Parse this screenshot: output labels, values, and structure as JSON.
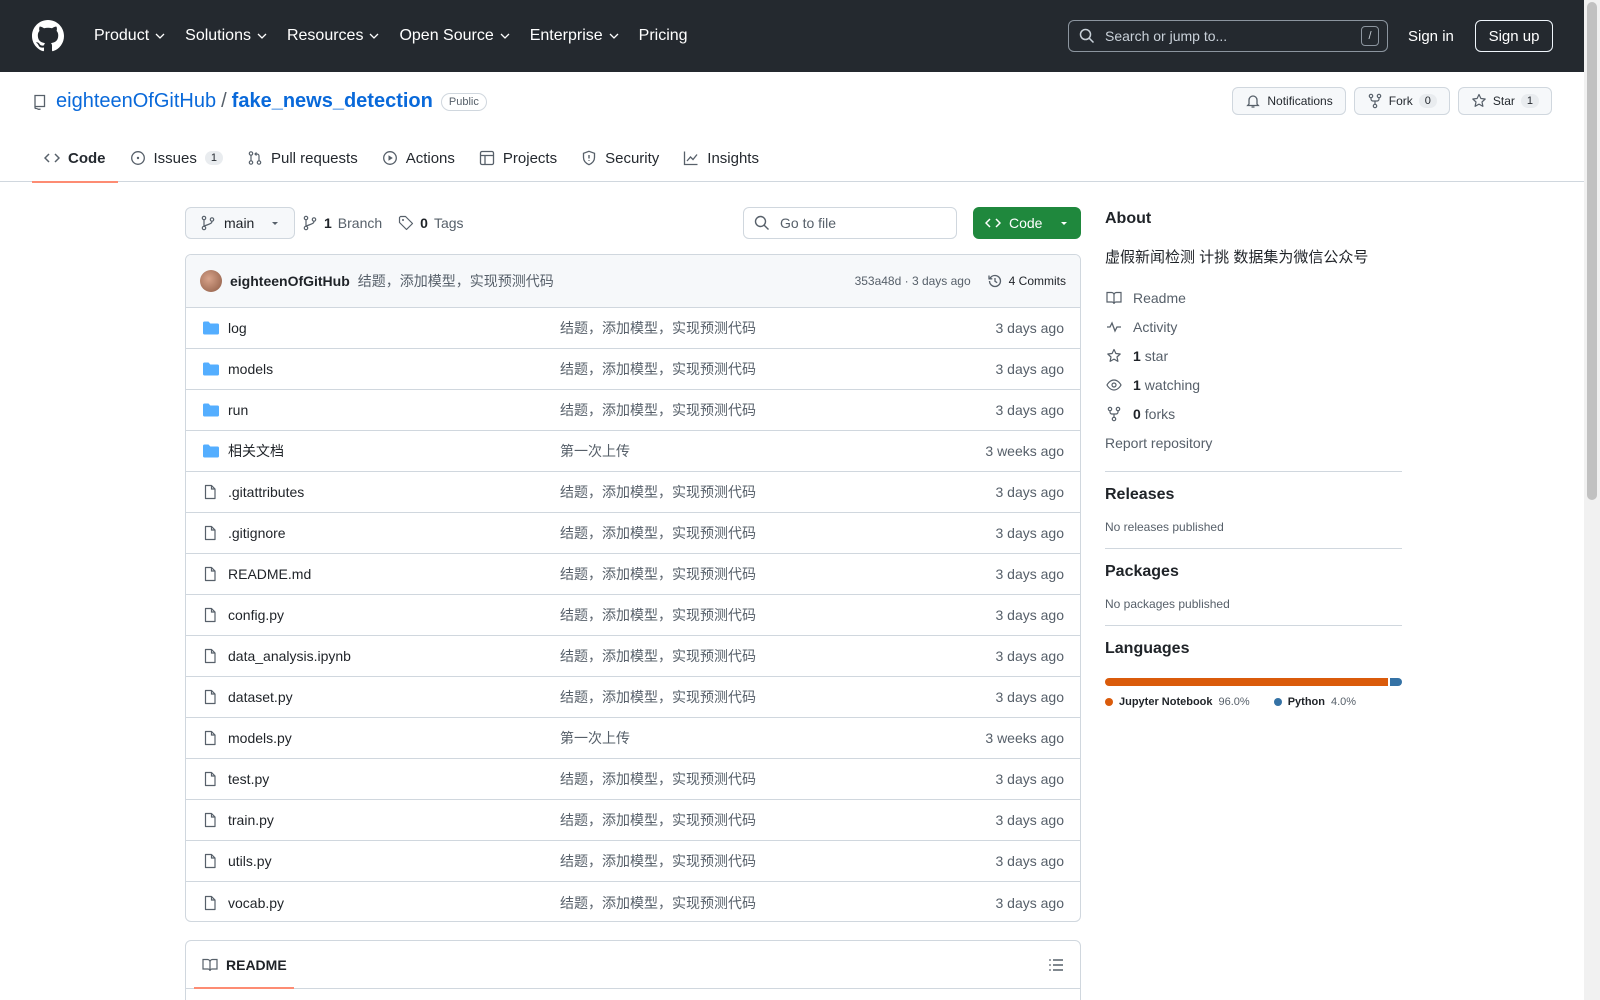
{
  "header": {
    "nav": [
      "Product",
      "Solutions",
      "Resources",
      "Open Source",
      "Enterprise",
      "Pricing"
    ],
    "search_placeholder": "Search or jump to...",
    "search_shortcut": "/",
    "sign_in": "Sign in",
    "sign_up": "Sign up"
  },
  "repo": {
    "owner": "eighteenOfGitHub",
    "separator": "/",
    "name": "fake_news_detection",
    "visibility": "Public",
    "notifications": "Notifications",
    "fork_label": "Fork",
    "fork_count": "0",
    "star_label": "Star",
    "star_count": "1"
  },
  "tabs": [
    {
      "label": "Code",
      "icon": "code-icon",
      "active": true
    },
    {
      "label": "Issues",
      "icon": "issue-icon",
      "count": "1"
    },
    {
      "label": "Pull requests",
      "icon": "pull-request-icon"
    },
    {
      "label": "Actions",
      "icon": "play-icon"
    },
    {
      "label": "Projects",
      "icon": "table-icon"
    },
    {
      "label": "Security",
      "icon": "shield-icon"
    },
    {
      "label": "Insights",
      "icon": "graph-icon"
    }
  ],
  "toolbar": {
    "branch": "main",
    "branch_count": "1",
    "branch_label": "Branch",
    "tag_count": "0",
    "tag_label": "Tags",
    "goto_placeholder": "Go to file",
    "code_button": "Code"
  },
  "commit": {
    "author": "eighteenOfGitHub",
    "message": "结题，添加模型，实现预测代码",
    "meta": "353a48d · 3 days ago",
    "commits": "4 Commits"
  },
  "files": [
    {
      "name": "log",
      "type": "dir",
      "message": "结题，添加模型，实现预测代码",
      "age": "3 days ago"
    },
    {
      "name": "models",
      "type": "dir",
      "message": "结题，添加模型，实现预测代码",
      "age": "3 days ago"
    },
    {
      "name": "run",
      "type": "dir",
      "message": "结题，添加模型，实现预测代码",
      "age": "3 days ago"
    },
    {
      "name": "相关文档",
      "type": "dir",
      "message": "第一次上传",
      "age": "3 weeks ago"
    },
    {
      "name": ".gitattributes",
      "type": "file",
      "message": "结题，添加模型，实现预测代码",
      "age": "3 days ago"
    },
    {
      "name": ".gitignore",
      "type": "file",
      "message": "结题，添加模型，实现预测代码",
      "age": "3 days ago"
    },
    {
      "name": "README.md",
      "type": "file",
      "message": "结题，添加模型，实现预测代码",
      "age": "3 days ago"
    },
    {
      "name": "config.py",
      "type": "file",
      "message": "结题，添加模型，实现预测代码",
      "age": "3 days ago"
    },
    {
      "name": "data_analysis.ipynb",
      "type": "file",
      "message": "结题，添加模型，实现预测代码",
      "age": "3 days ago"
    },
    {
      "name": "dataset.py",
      "type": "file",
      "message": "结题，添加模型，实现预测代码",
      "age": "3 days ago"
    },
    {
      "name": "models.py",
      "type": "file",
      "message": "第一次上传",
      "age": "3 weeks ago"
    },
    {
      "name": "test.py",
      "type": "file",
      "message": "结题，添加模型，实现预测代码",
      "age": "3 days ago"
    },
    {
      "name": "train.py",
      "type": "file",
      "message": "结题，添加模型，实现预测代码",
      "age": "3 days ago"
    },
    {
      "name": "utils.py",
      "type": "file",
      "message": "结题，添加模型，实现预测代码",
      "age": "3 days ago"
    },
    {
      "name": "vocab.py",
      "type": "file",
      "message": "结题，添加模型，实现预测代码",
      "age": "3 days ago"
    }
  ],
  "readme": {
    "title": "README"
  },
  "about": {
    "heading": "About",
    "description": "虚假新闻检测 计挑 数据集为微信公众号",
    "readme": "Readme",
    "activity": "Activity",
    "stars_count": "1",
    "stars_label": "star",
    "watching_count": "1",
    "watching_label": "watching",
    "forks_count": "0",
    "forks_label": "forks",
    "report": "Report repository"
  },
  "releases": {
    "heading": "Releases",
    "note": "No releases published"
  },
  "packages": {
    "heading": "Packages",
    "note": "No packages published"
  },
  "languages": {
    "heading": "Languages",
    "items": [
      {
        "name": "Jupyter Notebook",
        "percent": "96.0%",
        "value": 96.0,
        "color": "#DA5B0B"
      },
      {
        "name": "Python",
        "percent": "4.0%",
        "value": 4.0,
        "color": "#3572A5"
      }
    ]
  },
  "colors": {
    "header_bg": "#24292f",
    "link": "#0969da",
    "primary_button": "#1f883d",
    "tab_underline": "#fd8c73"
  }
}
